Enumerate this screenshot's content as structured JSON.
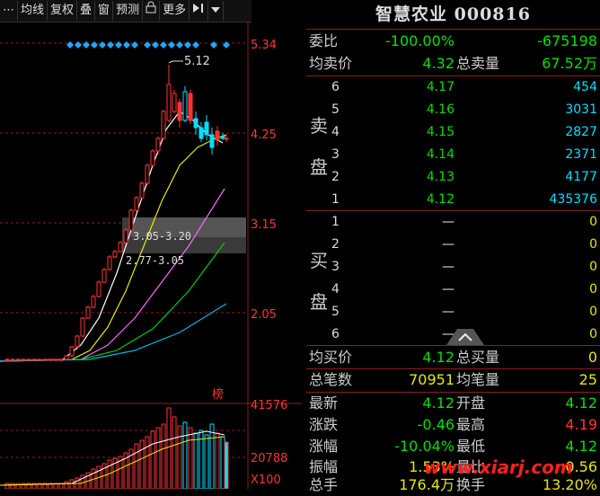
{
  "toolbar": {
    "items": [
      "⋯",
      "均线",
      "复权",
      "叠",
      "窗",
      "预测",
      "🔒",
      "更多",
      "⏵▌",
      "▾"
    ]
  },
  "chart": {
    "price_ticks": [
      "5.34",
      "4.25",
      "3.15",
      "2.05"
    ],
    "high_label": "5.12",
    "zone1": "3.05-3.20",
    "zone2": "2.77-3.05",
    "lhb_badge": "榜",
    "volume_ticks": [
      "41576",
      "20788"
    ],
    "volume_unit": "X100",
    "colors": {
      "up": "#ff3333",
      "down": "#00e0ff",
      "ma5": "#ffffff",
      "ma10": "#e8e800",
      "ma20": "#ff66ff",
      "ma30": "#00cc00",
      "ma60": "#00bbdd",
      "grid": "#8b1e1e"
    }
  },
  "quote": {
    "title": "智慧农业 000816",
    "wb": {
      "label": "委比",
      "pct": "-100.00%",
      "diff": "-675198"
    },
    "avg_sell": {
      "label": "均卖价",
      "value": "4.32",
      "total_label": "总卖量",
      "total": "67.52万"
    },
    "sell_side_label": "卖盘",
    "sell": [
      {
        "lv": "6",
        "price": "4.17",
        "vol": "454"
      },
      {
        "lv": "5",
        "price": "4.16",
        "vol": "3031"
      },
      {
        "lv": "4",
        "price": "4.15",
        "vol": "2827"
      },
      {
        "lv": "3",
        "price": "4.14",
        "vol": "2371"
      },
      {
        "lv": "2",
        "price": "4.13",
        "vol": "4177"
      },
      {
        "lv": "1",
        "price": "4.12",
        "vol": "435376"
      }
    ],
    "buy_side_label": "买盘",
    "buy": [
      {
        "lv": "1",
        "price": "—",
        "vol": "0"
      },
      {
        "lv": "2",
        "price": "—",
        "vol": "0"
      },
      {
        "lv": "3",
        "price": "—",
        "vol": "0"
      },
      {
        "lv": "4",
        "price": "—",
        "vol": "0"
      },
      {
        "lv": "5",
        "price": "—",
        "vol": "0"
      },
      {
        "lv": "6",
        "price": "—",
        "vol": "0"
      }
    ],
    "avg_buy": {
      "label": "均买价",
      "value": "4.12",
      "total_label": "总买量",
      "total": "0"
    },
    "trades": {
      "label": "总笔数",
      "value": "70951",
      "avg_label": "均笔量",
      "avg": "25"
    },
    "latest": {
      "label": "最新",
      "value": "4.12",
      "l2": "开盘",
      "v2": "4.12"
    },
    "change": {
      "label": "涨跌",
      "value": "-0.46",
      "l2": "最高",
      "v2": "4.19"
    },
    "change_pct": {
      "label": "涨幅",
      "value": "-10.04%",
      "l2": "最低",
      "v2": "4.12"
    },
    "amplitude": {
      "label": "振幅",
      "value": "1.53%",
      "l2": "量比",
      "v2": "0.56"
    },
    "total_hands": {
      "label": "总手",
      "value": "176.4万",
      "l2": "换手",
      "v2": "13.20%"
    }
  },
  "watermark": "www.xiarj.com"
}
